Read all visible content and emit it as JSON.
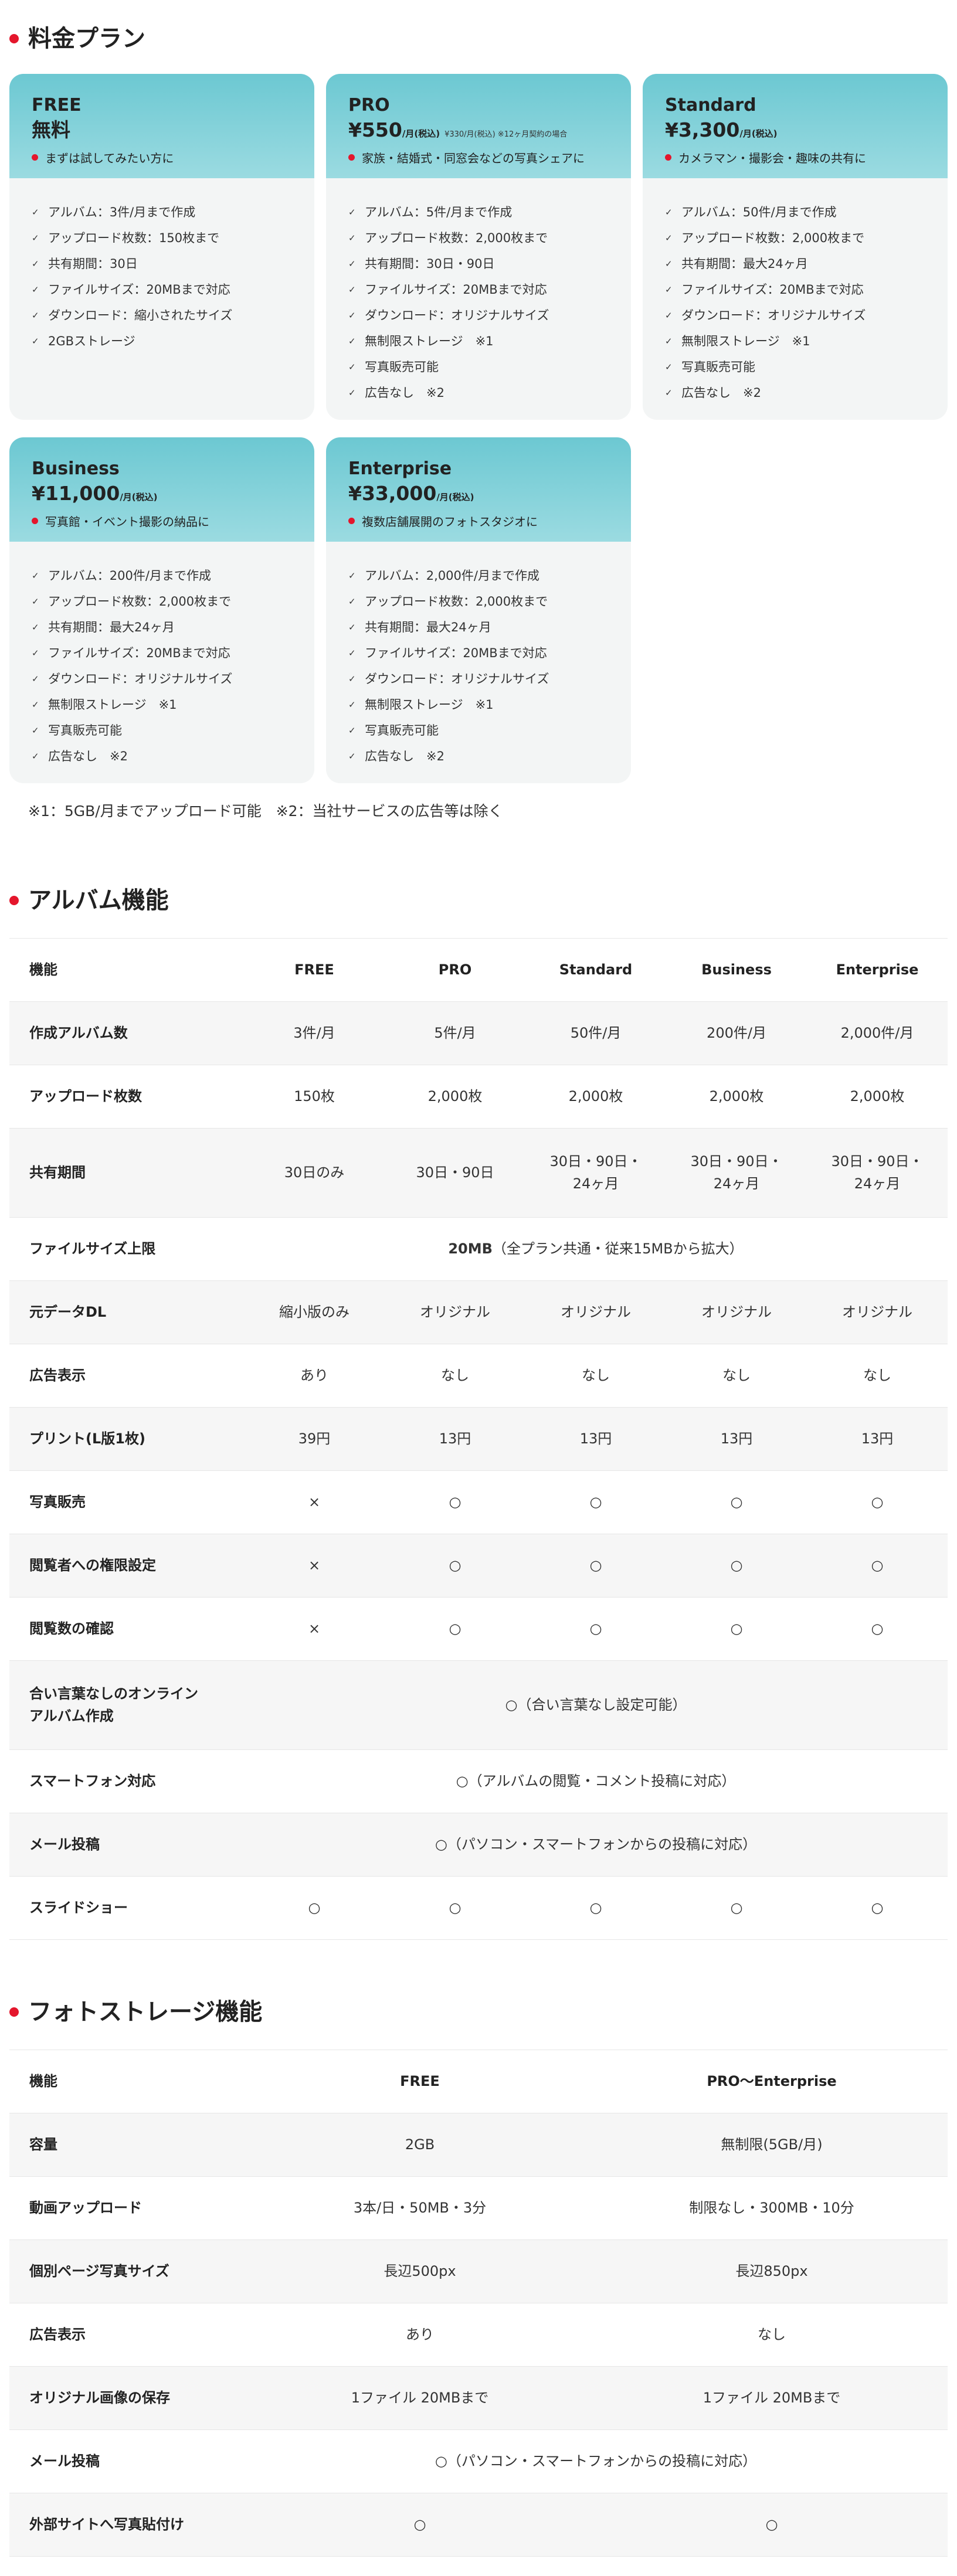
{
  "colors": {
    "accent_red": "#e4162c",
    "card_header": "#7fcfd7",
    "card_body": "#f3f5f5",
    "row_alt": "#f6f6f6"
  },
  "pricing": {
    "title": "料金プラン",
    "check_icon": "check-icon",
    "plans": [
      {
        "name": "FREE",
        "price": "無料",
        "unit": "",
        "price_note": "",
        "tagline": "まずは試してみたい方に",
        "features": [
          "アルバム：3件/月まで作成",
          "アップロード枚数：150枚まで",
          "共有期間：30日",
          "ファイルサイズ：20MBまで対応",
          "ダウンロード：縮小されたサイズ",
          "2GBストレージ"
        ]
      },
      {
        "name": "PRO",
        "price": "¥550",
        "unit": "/月(税込)",
        "price_note": "¥330/月(税込) ※12ヶ月契約の場合",
        "tagline": "家族・結婚式・同窓会などの写真シェアに",
        "features": [
          "アルバム：5件/月まで作成",
          "アップロード枚数：2,000枚まで",
          "共有期間：30日・90日",
          "ファイルサイズ：20MBまで対応",
          "ダウンロード：オリジナルサイズ",
          "無制限ストレージ　※1",
          "写真販売可能",
          "広告なし　※2"
        ]
      },
      {
        "name": "Standard",
        "price": "¥3,300",
        "unit": "/月(税込)",
        "price_note": "",
        "tagline": "カメラマン・撮影会・趣味の共有に",
        "features": [
          "アルバム：50件/月まで作成",
          "アップロード枚数：2,000枚まで",
          "共有期間：最大24ヶ月",
          "ファイルサイズ：20MBまで対応",
          "ダウンロード：オリジナルサイズ",
          "無制限ストレージ　※1",
          "写真販売可能",
          "広告なし　※2"
        ]
      },
      {
        "name": "Business",
        "price": "¥11,000",
        "unit": "/月(税込)",
        "price_note": "",
        "tagline": "写真館・イベント撮影の納品に",
        "features": [
          "アルバム：200件/月まで作成",
          "アップロード枚数：2,000枚まで",
          "共有期間：最大24ヶ月",
          "ファイルサイズ：20MBまで対応",
          "ダウンロード：オリジナルサイズ",
          "無制限ストレージ　※1",
          "写真販売可能",
          "広告なし　※2"
        ]
      },
      {
        "name": "Enterprise",
        "price": "¥33,000",
        "unit": "/月(税込)",
        "price_note": "",
        "tagline": "複数店舗展開のフォトスタジオに",
        "features": [
          "アルバム：2,000件/月まで作成",
          "アップロード枚数：2,000枚まで",
          "共有期間：最大24ヶ月",
          "ファイルサイズ：20MBまで対応",
          "ダウンロード：オリジナルサイズ",
          "無制限ストレージ　※1",
          "写真販売可能",
          "広告なし　※2"
        ]
      }
    ],
    "footnote": "※1：5GB/月までアップロード可能　※2：当社サービスの広告等は除く"
  },
  "album": {
    "title": "アルバム機能",
    "header": [
      "機能",
      "FREE",
      "PRO",
      "Standard",
      "Business",
      "Enterprise"
    ],
    "rows": [
      {
        "label": "作成アルバム数",
        "cells": [
          "3件/月",
          "5件/月",
          "50件/月",
          "200件/月",
          "2,000件/月"
        ]
      },
      {
        "label": "アップロード枚数",
        "cells": [
          "150枚",
          "2,000枚",
          "2,000枚",
          "2,000枚",
          "2,000枚"
        ]
      },
      {
        "label": "共有期間",
        "cells": [
          "30日のみ",
          "30日・90日",
          "30日・90日・24ヶ月",
          "30日・90日・24ヶ月",
          "30日・90日・24ヶ月"
        ]
      },
      {
        "label": "ファイルサイズ上限",
        "span_bold": "20MB",
        "span_rest": "（全プラン共通・従来15MBから拡大）"
      },
      {
        "label": "元データDL",
        "cells": [
          "縮小版のみ",
          "オリジナル",
          "オリジナル",
          "オリジナル",
          "オリジナル"
        ]
      },
      {
        "label": "広告表示",
        "cells": [
          "あり",
          "なし",
          "なし",
          "なし",
          "なし"
        ]
      },
      {
        "label": "プリント(L版1枚)",
        "cells": [
          "39円",
          "13円",
          "13円",
          "13円",
          "13円"
        ]
      },
      {
        "label": "写真販売",
        "cells": [
          "×",
          "○",
          "○",
          "○",
          "○"
        ]
      },
      {
        "label": "閲覧者への権限設定",
        "cells": [
          "×",
          "○",
          "○",
          "○",
          "○"
        ]
      },
      {
        "label": "閲覧数の確認",
        "cells": [
          "×",
          "○",
          "○",
          "○",
          "○"
        ]
      },
      {
        "label": "合い言葉なしのオンラインアルバム作成",
        "span_text": "○（合い言葉なし設定可能）"
      },
      {
        "label": "スマートフォン対応",
        "span_text": "○（アルバムの閲覧・コメント投稿に対応）"
      },
      {
        "label": "メール投稿",
        "span_text": "○（パソコン・スマートフォンからの投稿に対応）"
      },
      {
        "label": "スライドショー",
        "cells": [
          "○",
          "○",
          "○",
          "○",
          "○"
        ]
      }
    ]
  },
  "storage": {
    "title": "フォトストレージ機能",
    "header": [
      "機能",
      "FREE",
      "PRO〜Enterprise"
    ],
    "rows": [
      {
        "label": "容量",
        "cells": [
          "2GB",
          "無制限(5GB/月)"
        ]
      },
      {
        "label": "動画アップロード",
        "cells": [
          "3本/日・50MB・3分",
          "制限なし・300MB・10分"
        ]
      },
      {
        "label": "個別ページ写真サイズ",
        "cells": [
          "長辺500px",
          "長辺850px"
        ]
      },
      {
        "label": "広告表示",
        "cells": [
          "あり",
          "なし"
        ]
      },
      {
        "label": "オリジナル画像の保存",
        "cells": [
          "1ファイル 20MBまで",
          "1ファイル 20MBまで"
        ]
      },
      {
        "label": "メール投稿",
        "span_text": "○（パソコン・スマートフォンからの投稿に対応）"
      },
      {
        "label": "外部サイトへ写真貼付け",
        "cells": [
          "○",
          "○"
        ]
      }
    ]
  }
}
